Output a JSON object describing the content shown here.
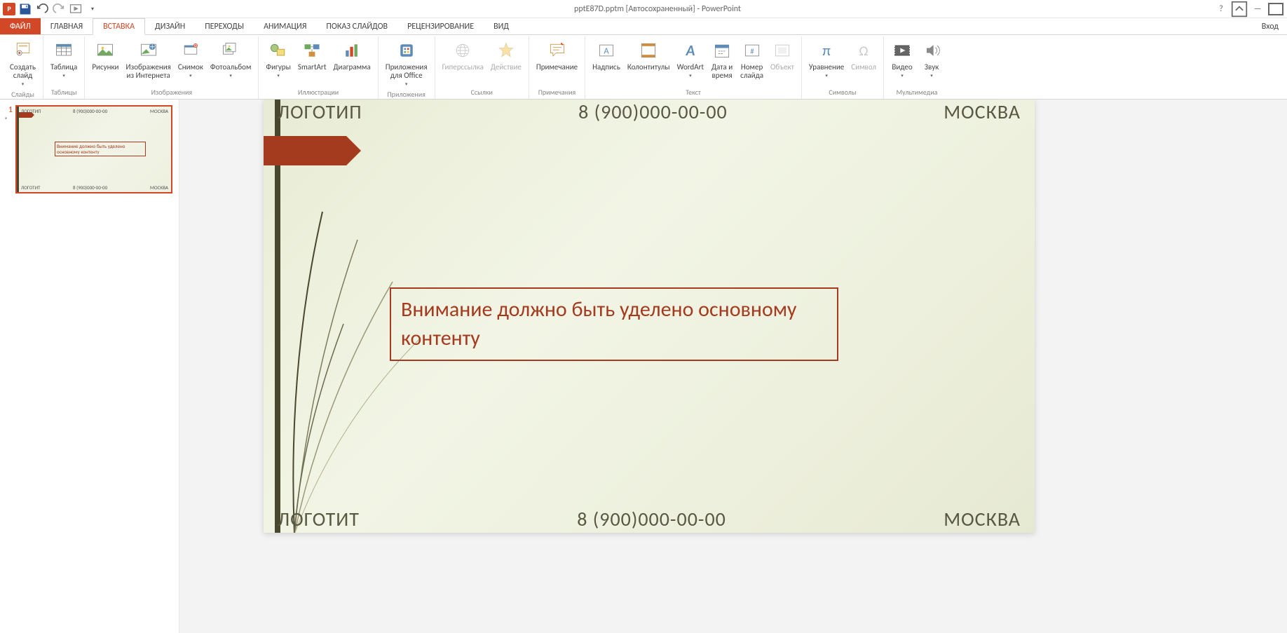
{
  "titlebar": {
    "title": "pptE87D.pptm [Автосохраненный] - PowerPoint",
    "signin": "Вход"
  },
  "tabs": {
    "file": "ФАЙЛ",
    "home": "ГЛАВНАЯ",
    "insert": "ВСТАВКА",
    "design": "ДИЗАЙН",
    "transitions": "ПЕРЕХОДЫ",
    "animation": "АНИМАЦИЯ",
    "slideshow": "ПОКАЗ СЛАЙДОВ",
    "review": "РЕЦЕНЗИРОВАНИЕ",
    "view": "ВИД"
  },
  "ribbon": {
    "slides": {
      "new_slide": "Создать\nслайд",
      "group": "Слайды"
    },
    "tables": {
      "table": "Таблица",
      "group": "Таблицы"
    },
    "images": {
      "pictures": "Рисунки",
      "online": "Изображения\nиз Интернета",
      "screenshot": "Снимок",
      "album": "Фотоальбом",
      "group": "Изображения"
    },
    "illustr": {
      "shapes": "Фигуры",
      "smartart": "SmartArt",
      "chart": "Диаграмма",
      "group": "Иллюстрации"
    },
    "apps": {
      "office": "Приложения\nдля Office",
      "group": "Приложения"
    },
    "links": {
      "hyperlink": "Гиперссылка",
      "action": "Действие",
      "group": "Ссылки"
    },
    "comments": {
      "comment": "Примечание",
      "group": "Примечания"
    },
    "text": {
      "textbox": "Надпись",
      "headerfooter": "Колонтитулы",
      "wordart": "WordArt",
      "datetime": "Дата и\nвремя",
      "slidenum": "Номер\nслайда",
      "object": "Объект",
      "group": "Текст"
    },
    "symbols": {
      "equation": "Уравнение",
      "symbol": "Символ",
      "group": "Символы"
    },
    "media": {
      "video": "Видео",
      "audio": "Звук",
      "group": "Мультимедиа"
    }
  },
  "thumbnail": {
    "number": "1",
    "star": "*",
    "top_logo": "ЛОГОТИП",
    "top_phone": "8 (900)000-00-00",
    "top_city": "МОСКВА",
    "box": "Внимание должно быть уделено основному контенту",
    "bot_logo": "ЛОГОТИТ",
    "bot_phone": "8 (900)000-00-00",
    "bot_city": "МОСКВА"
  },
  "slide": {
    "top_logo": "ЛОГОТИП",
    "top_phone": "8 (900)000-00-00",
    "top_city": "МОСКВА",
    "content": "Внимание должно быть уделено основному контенту",
    "bot_logo": "ЛОГОТИТ",
    "bot_phone": "8 (900)000-00-00",
    "bot_city": "МОСКВА"
  }
}
